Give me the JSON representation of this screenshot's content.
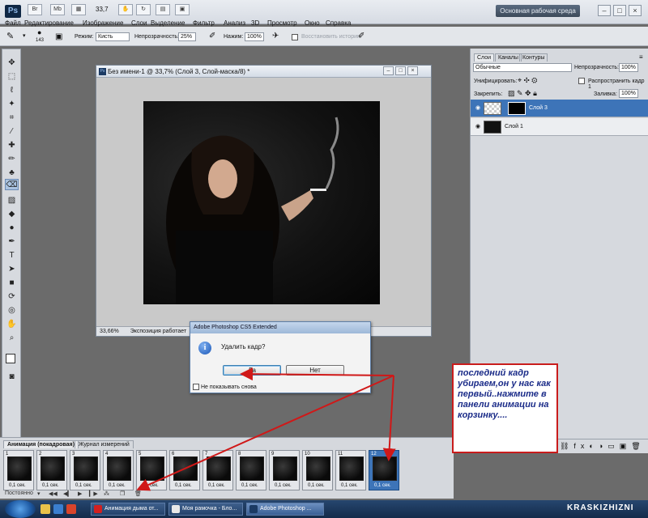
{
  "app": {
    "logo": "Ps",
    "menu": [
      "Файл",
      "Редактирование",
      "Изображение",
      "Слои",
      "Выделение",
      "Фильтр",
      "Анализ",
      "3D",
      "Просмотр",
      "Окно",
      "Справка"
    ],
    "zoom": "33,7",
    "workspace": "Основная рабочая среда"
  },
  "options": {
    "brush_size": "143",
    "mode_label": "Режим:",
    "mode_value": "Кисть",
    "opacity_label": "Непрозрачность:",
    "opacity_value": "25%",
    "flow_label": "Нажим:",
    "flow_value": "100%",
    "history_label": "Восстановить историю"
  },
  "document": {
    "title": "Без имени-1 @ 33,7% (Слой 3, Слой-маска/8) *",
    "status_zoom": "33,66%",
    "status_text": "Экспозиция работает"
  },
  "layers_panel": {
    "tabs": [
      "Слои",
      "Каналы",
      "Контуры"
    ],
    "blend_mode": "Обычные",
    "opacity_label": "Непрозрачность:",
    "opacity_value": "100%",
    "unify_label": "Унифицировать:",
    "propagate_label": "Распространить кадр 1",
    "lock_label": "Закрепить:",
    "fill_label": "Заливка:",
    "fill_value": "100%",
    "layers": [
      {
        "name": "Слой 3",
        "selected": true
      },
      {
        "name": "Слой 1",
        "selected": false
      }
    ]
  },
  "dialog": {
    "title": "Adobe Photoshop CS5 Extended",
    "message": "Удалить кадр?",
    "yes_label": "Да",
    "no_label": "Нет",
    "dont_show_label": "Не показывать снова"
  },
  "note": {
    "text": "последний кадр убираем,он у нас как первый..нажмите в панели анимации на корзинку...."
  },
  "animation_panel": {
    "tabs": [
      "Анимация (покадровая)",
      "Журнал измерений"
    ],
    "frames": [
      {
        "num": "1",
        "time": "0,1 сек."
      },
      {
        "num": "2",
        "time": "0,1 сек."
      },
      {
        "num": "3",
        "time": "0,1 сек."
      },
      {
        "num": "4",
        "time": "0,1 сек."
      },
      {
        "num": "5",
        "time": "0,1 сек."
      },
      {
        "num": "6",
        "time": "0,1 сек."
      },
      {
        "num": "7",
        "time": "0,1 сек."
      },
      {
        "num": "8",
        "time": "0,1 сек."
      },
      {
        "num": "9",
        "time": "0,1 сек."
      },
      {
        "num": "10",
        "time": "0,1 сек."
      },
      {
        "num": "11",
        "time": "0,1 сек."
      },
      {
        "num": "12",
        "time": "0,1 сек."
      }
    ],
    "loop_label": "Постоянно"
  },
  "taskbar": {
    "tasks": [
      "Анимация дыма от...",
      "Моя рамочка - Бло...",
      "Adobe Photoshop ..."
    ],
    "watermark": "KRASKIZHIZNI"
  },
  "colors": {
    "selection_blue": "#3d74b8",
    "note_border": "#c91c1c",
    "note_text": "#1a2b88",
    "arrow_red": "#d01818"
  }
}
